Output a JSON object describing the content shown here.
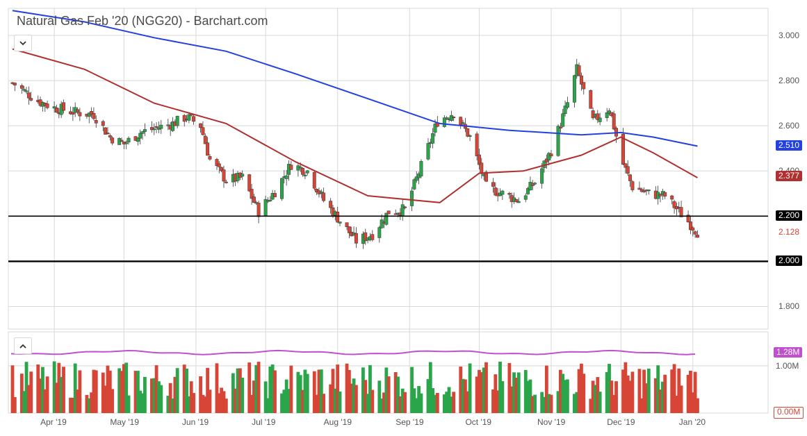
{
  "title": "Natural Gas Feb '20 (NGG20) - Barchart.com",
  "colors": {
    "up": "#2aa54a",
    "down": "#d64536",
    "ma_long": "#2340e0",
    "ma_short": "#b03030",
    "volume_avg": "#c050d0",
    "grid": "#d8d8d8"
  },
  "buttons": {
    "collapse_icon": "chevron-down-icon",
    "expand_icon": "chevron-up-icon"
  },
  "chart_data": [
    {
      "type": "candlestick",
      "panel": "price",
      "title": "Natural Gas Feb '20 (NGG20) - Barchart.com",
      "ylim": [
        1.7,
        3.12
      ],
      "y_ticks": [
        "3.000",
        "2.800",
        "2.600",
        "2.400",
        "1.800"
      ],
      "x_ticks": [
        "Apr '19",
        "May '19",
        "Jun '19",
        "Jul '19",
        "Aug '19",
        "Sep '19",
        "Oct '19",
        "Nov '19",
        "Dec '19",
        "Jan '20"
      ],
      "x_start": "2019-03-14",
      "x_end": "2020-01-03",
      "horizontal_lines": [
        {
          "value": 2.2,
          "label": "2.200"
        },
        {
          "value": 2.0,
          "label": "2.000"
        }
      ],
      "last_price": {
        "value": 2.128,
        "label": "2.128"
      },
      "close_series_approx": [
        [
          "2019-03-14",
          2.79
        ],
        [
          "2019-03-25",
          2.71
        ],
        [
          "2019-04-01",
          2.68
        ],
        [
          "2019-04-10",
          2.66
        ],
        [
          "2019-04-18",
          2.65
        ],
        [
          "2019-04-25",
          2.55
        ],
        [
          "2019-05-01",
          2.52
        ],
        [
          "2019-05-08",
          2.57
        ],
        [
          "2019-05-15",
          2.59
        ],
        [
          "2019-05-22",
          2.61
        ],
        [
          "2019-05-28",
          2.64
        ],
        [
          "2019-06-03",
          2.6
        ],
        [
          "2019-06-07",
          2.45
        ],
        [
          "2019-06-14",
          2.36
        ],
        [
          "2019-06-21",
          2.37
        ],
        [
          "2019-06-28",
          2.22
        ],
        [
          "2019-07-05",
          2.31
        ],
        [
          "2019-07-12",
          2.43
        ],
        [
          "2019-07-19",
          2.4
        ],
        [
          "2019-07-26",
          2.27
        ],
        [
          "2019-08-02",
          2.18
        ],
        [
          "2019-08-09",
          2.09
        ],
        [
          "2019-08-16",
          2.12
        ],
        [
          "2019-08-23",
          2.22
        ],
        [
          "2019-08-30",
          2.23
        ],
        [
          "2019-09-06",
          2.42
        ],
        [
          "2019-09-13",
          2.62
        ],
        [
          "2019-09-20",
          2.66
        ],
        [
          "2019-09-27",
          2.55
        ],
        [
          "2019-10-04",
          2.33
        ],
        [
          "2019-10-11",
          2.3
        ],
        [
          "2019-10-18",
          2.27
        ],
        [
          "2019-10-25",
          2.35
        ],
        [
          "2019-11-01",
          2.49
        ],
        [
          "2019-11-08",
          2.7
        ],
        [
          "2019-11-12",
          2.85
        ],
        [
          "2019-11-19",
          2.62
        ],
        [
          "2019-11-26",
          2.68
        ],
        [
          "2019-12-02",
          2.43
        ],
        [
          "2019-12-06",
          2.33
        ],
        [
          "2019-12-13",
          2.3
        ],
        [
          "2019-12-20",
          2.29
        ],
        [
          "2019-12-27",
          2.21
        ],
        [
          "2020-01-03",
          2.13
        ]
      ],
      "series": [
        {
          "name": "",
          "type": "line",
          "color_ref": "ma_long",
          "last_value": 2.51,
          "label": "2.510",
          "points": [
            [
              "2019-03-14",
              3.11
            ],
            [
              "2019-04-14",
              3.06
            ],
            [
              "2019-05-14",
              2.99
            ],
            [
              "2019-06-14",
              2.93
            ],
            [
              "2019-07-14",
              2.83
            ],
            [
              "2019-08-14",
              2.72
            ],
            [
              "2019-09-14",
              2.61
            ],
            [
              "2019-10-14",
              2.58
            ],
            [
              "2019-11-14",
              2.56
            ],
            [
              "2019-12-01",
              2.57
            ],
            [
              "2019-12-15",
              2.55
            ],
            [
              "2020-01-03",
              2.51
            ]
          ]
        },
        {
          "name": "",
          "type": "line",
          "color_ref": "ma_short",
          "last_value": 2.377,
          "label": "2.377",
          "points": [
            [
              "2019-03-14",
              2.94
            ],
            [
              "2019-04-14",
              2.85
            ],
            [
              "2019-05-14",
              2.7
            ],
            [
              "2019-06-14",
              2.61
            ],
            [
              "2019-07-14",
              2.44
            ],
            [
              "2019-08-14",
              2.29
            ],
            [
              "2019-09-14",
              2.26
            ],
            [
              "2019-10-01",
              2.39
            ],
            [
              "2019-10-20",
              2.4
            ],
            [
              "2019-11-14",
              2.47
            ],
            [
              "2019-12-01",
              2.55
            ],
            [
              "2019-12-15",
              2.48
            ],
            [
              "2020-01-03",
              2.37
            ]
          ]
        }
      ]
    },
    {
      "type": "bar",
      "panel": "volume",
      "ylim": [
        0,
        1.6
      ],
      "y_ticks": [
        "1.00M"
      ],
      "current_value_label": "0.00M",
      "average_line_label": "1.28M",
      "average_value_millions": 1.28,
      "volume_range_millions": [
        0.3,
        1.1
      ]
    }
  ]
}
